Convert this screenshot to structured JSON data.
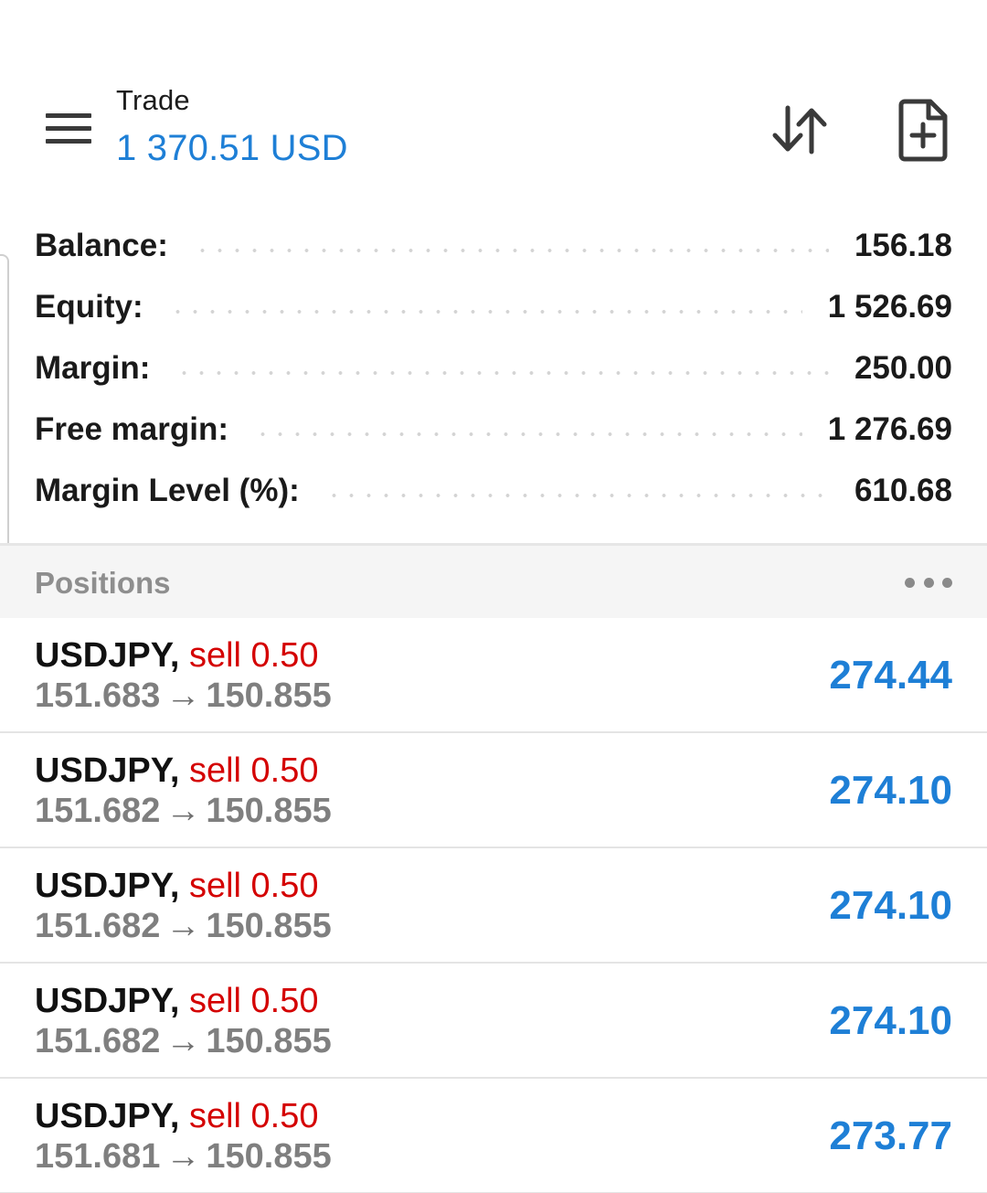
{
  "header": {
    "title": "Trade",
    "subtitle": "1 370.51 USD",
    "menu_icon": "hamburger-menu-icon",
    "sort_icon": "sort-arrows-icon",
    "new_order_icon": "new-document-plus-icon"
  },
  "account": {
    "balance_label": "Balance:",
    "balance_value": "156.18",
    "equity_label": "Equity:",
    "equity_value": "1 526.69",
    "margin_label": "Margin:",
    "margin_value": "250.00",
    "free_margin_label": "Free margin:",
    "free_margin_value": "1 276.69",
    "margin_level_label": "Margin Level (%):",
    "margin_level_value": "610.68"
  },
  "positions": {
    "title": "Positions",
    "more_icon": "more-horizontal-icon",
    "items": [
      {
        "symbol": "USDJPY,",
        "trade": "sell 0.50",
        "open_price": "151.683",
        "arrow": "→",
        "current_price": "150.855",
        "profit": "274.44"
      },
      {
        "symbol": "USDJPY,",
        "trade": "sell 0.50",
        "open_price": "151.682",
        "arrow": "→",
        "current_price": "150.855",
        "profit": "274.10"
      },
      {
        "symbol": "USDJPY,",
        "trade": "sell 0.50",
        "open_price": "151.682",
        "arrow": "→",
        "current_price": "150.855",
        "profit": "274.10"
      },
      {
        "symbol": "USDJPY,",
        "trade": "sell 0.50",
        "open_price": "151.682",
        "arrow": "→",
        "current_price": "150.855",
        "profit": "274.10"
      },
      {
        "symbol": "USDJPY,",
        "trade": "sell 0.50",
        "open_price": "151.681",
        "arrow": "→",
        "current_price": "150.855",
        "profit": "273.77"
      }
    ]
  },
  "colors": {
    "accent_blue": "#1e7fd6",
    "sell_red": "#d40000",
    "muted_gray": "#7f7f7f"
  }
}
